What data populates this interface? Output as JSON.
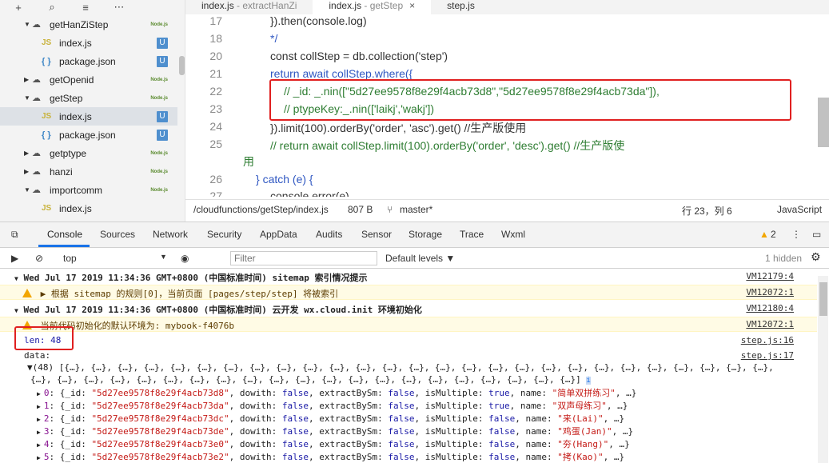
{
  "sidebar": {
    "toolbar_icons": [
      "plus-icon",
      "search-icon",
      "collapse-icon",
      "more-icon"
    ],
    "toolbar_glyphs": [
      "+",
      "⌕",
      "≡",
      "⋯"
    ],
    "items": [
      {
        "label": "getHanZiStep",
        "type": "folder",
        "expanded": true,
        "badge": "Node.js"
      },
      {
        "label": "index.js",
        "type": "js",
        "badge": "U"
      },
      {
        "label": "package.json",
        "type": "json",
        "badge": "U"
      },
      {
        "label": "getOpenid",
        "type": "folder",
        "expanded": false,
        "badge": "Node.js"
      },
      {
        "label": "getStep",
        "type": "folder",
        "expanded": true,
        "badge": "Node.js"
      },
      {
        "label": "index.js",
        "type": "js",
        "badge": "U",
        "selected": true
      },
      {
        "label": "package.json",
        "type": "json",
        "badge": "U"
      },
      {
        "label": "getptype",
        "type": "folder",
        "expanded": false,
        "badge": "Node.js"
      },
      {
        "label": "hanzi",
        "type": "folder",
        "expanded": false,
        "badge": "Node.js"
      },
      {
        "label": "importcomm",
        "type": "folder",
        "expanded": true,
        "badge": "Node.js"
      },
      {
        "label": "index.js",
        "type": "js",
        "badge": ""
      }
    ]
  },
  "tabs": [
    {
      "name": "index.js",
      "sub": "- extractHanZi",
      "active": false
    },
    {
      "name": "index.js",
      "sub": "- getStep",
      "active": true,
      "close": "×"
    },
    {
      "name": "step.js",
      "sub": "",
      "active": false
    }
  ],
  "editor": {
    "lines": [
      {
        "n": "17",
        "text": "}).then(console.log)"
      },
      {
        "n": "18",
        "text": "*/"
      },
      {
        "n": "20",
        "text": "const collStep = db.collection('step')"
      },
      {
        "n": "21",
        "text": "return await collStep.where({"
      },
      {
        "n": "22",
        "text": "// _id: _.nin([\"5d27ee9578f8e29f4acb73d8\",\"5d27ee9578f8e29f4acb73da\"]),"
      },
      {
        "n": "23",
        "text": "// ptypeKey:_.nin(['laikj','wakj'])"
      },
      {
        "n": "24",
        "text": "}).limit(100).orderBy('order', 'asc').get() //生产版使用"
      },
      {
        "n": "25",
        "text": "// return await collStep.limit(100).orderBy('order', 'desc').get() //生产版使"
      },
      {
        "n": "",
        "text": "用"
      },
      {
        "n": "26",
        "text": "} catch (e) {"
      },
      {
        "n": "27",
        "text": "console.error(e)"
      }
    ]
  },
  "status": {
    "path": "/cloudfunctions/getStep/index.js",
    "size": "807 B",
    "branch": "master*",
    "position": "行 23，列 6",
    "language": "JavaScript"
  },
  "devtools": {
    "tabs": [
      "Console",
      "Sources",
      "Network",
      "Security",
      "AppData",
      "Audits",
      "Sensor",
      "Storage",
      "Trace",
      "Wxml"
    ],
    "warn_count": "2",
    "context": "top",
    "filter_placeholder": "Filter",
    "levels": "Default levels ▼",
    "hidden": "1 hidden",
    "logs": [
      {
        "kind": "group",
        "text": "Wed Jul 17 2019 11:34:36 GMT+0800 (中国标准时间) sitemap 索引情况提示",
        "src": "VM12179:4"
      },
      {
        "kind": "warn",
        "text": "▶ 根据 sitemap 的规则[0]，当前页面 [pages/step/step] 将被索引",
        "src": "VM12072:1"
      },
      {
        "kind": "group",
        "text": "Wed Jul 17 2019 11:34:36 GMT+0800 (中国标准时间) 云开发 wx.cloud.init 环境初始化",
        "src": "VM12180:4"
      },
      {
        "kind": "warn",
        "text": "当前代码初始化的默认环境为: mybook-f4076b",
        "src": "VM12072:1"
      },
      {
        "kind": "log",
        "label": "len:",
        "value": "48",
        "src": "step.js:16"
      },
      {
        "kind": "log",
        "label": "data:",
        "value": "",
        "src": "step.js:17"
      }
    ],
    "array_line1": "▼(48) [{…}, {…}, {…}, {…}, {…}, {…}, {…}, {…}, {…}, {…}, {…}, {…}, {…}, {…}, {…}, {…}, {…}, {…}, {…}, {…}, {…}, {…}, {…}, {…}, {…}, {…}, {…},",
    "array_line2": "{…}, {…}, {…}, {…}, {…}, {…}, {…}, {…}, {…}, {…}, {…}, {…}, {…}, {…}, {…}, {…}, {…}, {…}, {…}, {…}, {…}]",
    "records": [
      {
        "i": "0",
        "id": "\"5d27ee9578f8e29f4acb73d8\"",
        "dowith": "false",
        "extract": "false",
        "multiple": "true",
        "name": "\"简单双拼练习\""
      },
      {
        "i": "1",
        "id": "\"5d27ee9578f8e29f4acb73da\"",
        "dowith": "false",
        "extract": "false",
        "multiple": "true",
        "name": "\"双声母练习\""
      },
      {
        "i": "2",
        "id": "\"5d27ee9578f8e29f4acb73dc\"",
        "dowith": "false",
        "extract": "false",
        "multiple": "false",
        "name": "\"来(Lai)\""
      },
      {
        "i": "3",
        "id": "\"5d27ee9578f8e29f4acb73de\"",
        "dowith": "false",
        "extract": "false",
        "multiple": "false",
        "name": "\"鸡蛋(Jan)\""
      },
      {
        "i": "4",
        "id": "\"5d27ee9578f8e29f4acb73e0\"",
        "dowith": "false",
        "extract": "false",
        "multiple": "false",
        "name": "\"夯(Hang)\""
      },
      {
        "i": "5",
        "id": "\"5d27ee9578f8e29f4acb73e2\"",
        "dowith": "false",
        "extract": "false",
        "multiple": "false",
        "name": "\"拷(Kao)\""
      }
    ]
  }
}
